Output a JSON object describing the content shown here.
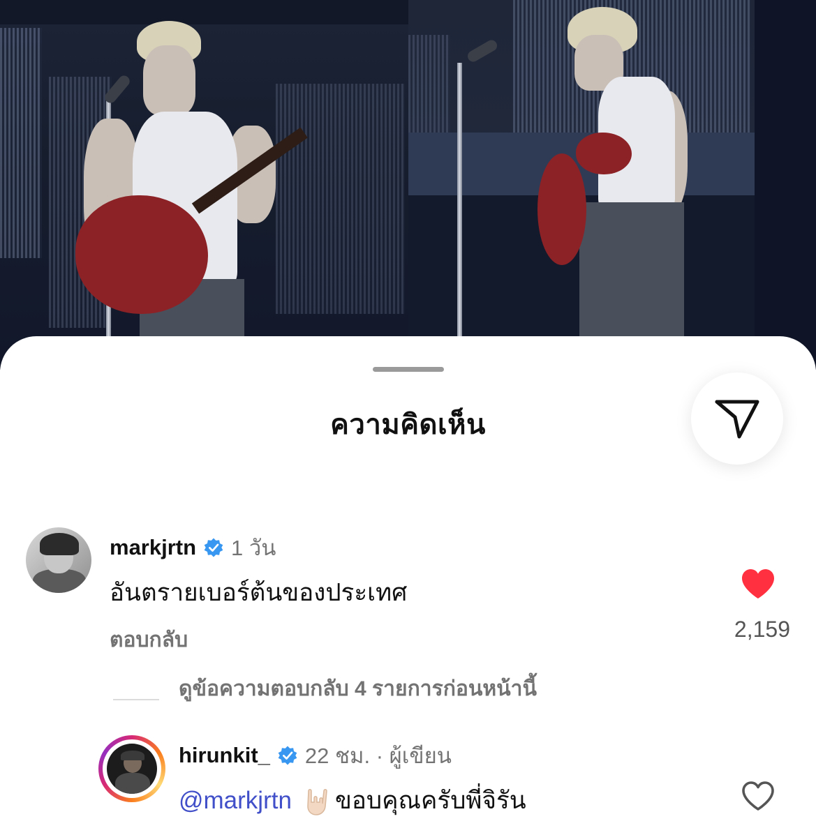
{
  "sheet": {
    "title": "ความคิดเห็น"
  },
  "icons": {
    "share": "send-icon",
    "verified": "verified-badge-icon",
    "like_filled": "heart-filled-icon",
    "like_outline": "heart-outline-icon",
    "gesture": "rock-on-hand-emoji"
  },
  "comments": [
    {
      "username": "markjrtn",
      "time": "1 วัน",
      "text": "อันตรายเบอร์ต้นของประเทศ",
      "reply_label": "ตอบกลับ",
      "likes": "2,159",
      "liked": true
    }
  ],
  "view_replies": "ดูข้อความตอบกลับ 4 รายการก่อนหน้านี้",
  "replies": [
    {
      "username": "hirunkit_",
      "meta": "22 ชม. · ผู้เขียน",
      "mention": "@markjrtn",
      "text": "ขอบคุณครับพี่จิรัน",
      "liked": false
    }
  ],
  "colors": {
    "accent_blue": "#0095f6",
    "mention": "#4150c8",
    "like_red": "#ff3040",
    "muted_text": "#737373"
  }
}
